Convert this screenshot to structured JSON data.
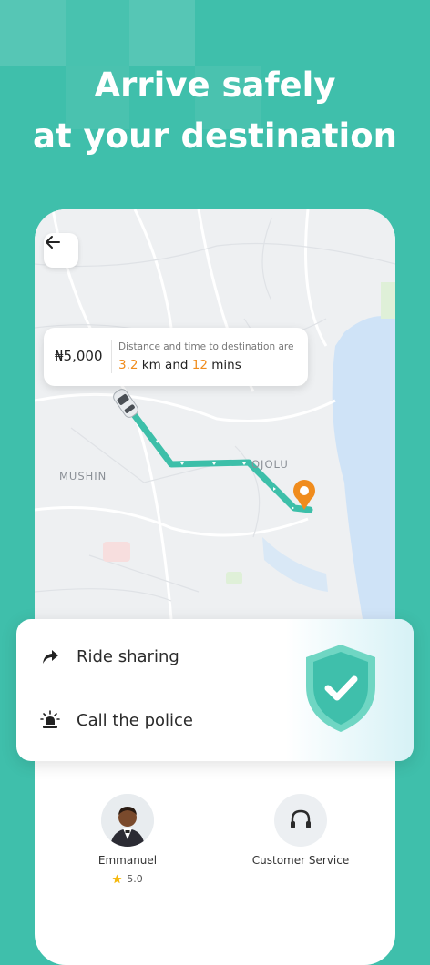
{
  "headline": {
    "line1": "Arrive safely",
    "line2": "at your destination"
  },
  "trip": {
    "fare": "₦5,000",
    "distance_label": "Distance and time to destination are",
    "distance_value": "3.2",
    "distance_unit": "km and",
    "time_value": "12",
    "time_unit": "mins"
  },
  "map": {
    "labels": [
      "MUSHIN",
      "OJOLU"
    ]
  },
  "safety": {
    "items": [
      {
        "label": "Ride sharing",
        "icon": "share-arrow-icon"
      },
      {
        "label": "Call the police",
        "icon": "police-siren-icon"
      }
    ],
    "badge_icon": "shield-check-icon"
  },
  "contacts": {
    "driver": {
      "name": "Emmanuel",
      "rating": "5.0"
    },
    "support": {
      "name": "Customer Service",
      "icon": "headset-icon"
    }
  },
  "colors": {
    "brand": "#3fbfab",
    "route": "#3dbfa9",
    "accent": "#f08c1d",
    "water": "#cfe3f7"
  }
}
